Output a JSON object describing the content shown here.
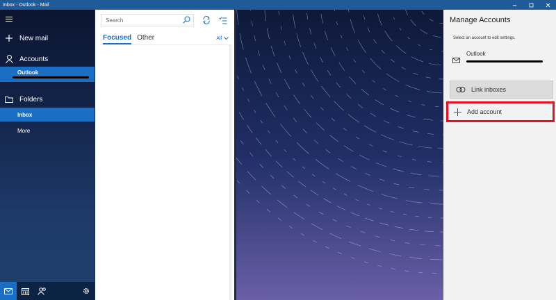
{
  "window": {
    "title": "Inbox - Outlook - Mail",
    "minimize_icon": "minimize-icon",
    "maximize_icon": "maximize-icon",
    "close_icon": "close-icon"
  },
  "nav": {
    "new_mail": "New mail",
    "accounts": "Accounts",
    "account_name": "Outlook",
    "folders": "Folders",
    "inbox": "Inbox",
    "more": "More",
    "bottom_icons": [
      "mail-icon",
      "calendar-icon",
      "people-icon",
      "gear-icon"
    ]
  },
  "list": {
    "search_placeholder": "Search",
    "tabs": [
      "Focused",
      "Other"
    ],
    "filter": "All"
  },
  "panel": {
    "title": "Manage Accounts",
    "subtitle": "Select an account to edit settings.",
    "account_label": "Outlook",
    "link_inboxes": "Link inboxes",
    "add_account": "Add account"
  },
  "colors": {
    "accent": "#1a6fc4",
    "titlebar": "#1f5a99",
    "highlight": "#e81123"
  }
}
